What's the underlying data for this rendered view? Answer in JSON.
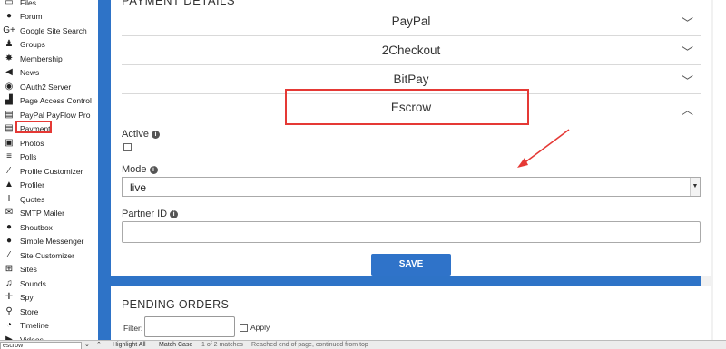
{
  "sidebar": {
    "items": [
      {
        "label": "Files",
        "icon": "file-icon",
        "glyph": "▭"
      },
      {
        "label": "Forum",
        "icon": "chat-bubbles-icon",
        "glyph": "●"
      },
      {
        "label": "Google Site Search",
        "icon": "google-plus-icon",
        "glyph": "G+"
      },
      {
        "label": "Groups",
        "icon": "users-icon",
        "glyph": "♟"
      },
      {
        "label": "Membership",
        "icon": "cog-icon",
        "glyph": "✸"
      },
      {
        "label": "News",
        "icon": "megaphone-icon",
        "glyph": "◀"
      },
      {
        "label": "OAuth2 Server",
        "icon": "globe-icon",
        "glyph": "◉"
      },
      {
        "label": "Page Access Control",
        "icon": "unlock-icon",
        "glyph": "▟"
      },
      {
        "label": "PayPal PayFlow Pro",
        "icon": "credit-card-icon",
        "glyph": "▤"
      },
      {
        "label": "Payment",
        "icon": "credit-card-icon",
        "glyph": "▤"
      },
      {
        "label": "Photos",
        "icon": "image-icon",
        "glyph": "▣"
      },
      {
        "label": "Polls",
        "icon": "tasks-icon",
        "glyph": "≡"
      },
      {
        "label": "Profile Customizer",
        "icon": "magic-wand-icon",
        "glyph": "⁄"
      },
      {
        "label": "Profiler",
        "icon": "flask-icon",
        "glyph": "▲"
      },
      {
        "label": "Quotes",
        "icon": "italic-icon",
        "glyph": "I"
      },
      {
        "label": "SMTP Mailer",
        "icon": "envelope-icon",
        "glyph": "✉"
      },
      {
        "label": "Shoutbox",
        "icon": "comment-icon",
        "glyph": "●"
      },
      {
        "label": "Simple Messenger",
        "icon": "comments-icon",
        "glyph": "●"
      },
      {
        "label": "Site Customizer",
        "icon": "magic-wand-icon",
        "glyph": "⁄"
      },
      {
        "label": "Sites",
        "icon": "sitemap-icon",
        "glyph": "⊞"
      },
      {
        "label": "Sounds",
        "icon": "music-icon",
        "glyph": "♫"
      },
      {
        "label": "Spy",
        "icon": "crosshairs-icon",
        "glyph": "✛"
      },
      {
        "label": "Store",
        "icon": "shopping-cart-icon",
        "glyph": "⚲"
      },
      {
        "label": "Timeline",
        "icon": "clock-icon",
        "glyph": "◔"
      },
      {
        "label": "Videos",
        "icon": "video-icon",
        "glyph": "▶"
      }
    ]
  },
  "payment": {
    "section_title": "PAYMENT DETAILS",
    "providers": [
      {
        "label": "PayPal",
        "chevron": "﹀"
      },
      {
        "label": "2Checkout",
        "chevron": "﹀"
      },
      {
        "label": "BitPay",
        "chevron": "﹀"
      },
      {
        "label": "Escrow",
        "chevron": "︿"
      }
    ],
    "active_label": "Active",
    "mode_label": "Mode",
    "mode_value": "live",
    "partner_label": "Partner ID",
    "partner_value": "",
    "save_label": "SAVE"
  },
  "pending": {
    "title": "PENDING ORDERS",
    "filter_label": "Filter:",
    "filter_value": "",
    "apply_label": "Apply"
  },
  "findbar": {
    "query": "escrow",
    "highlight_all": "Highlight All",
    "match_case": "Match Case",
    "matches": "1 of 2 matches",
    "status": "Reached end of page, continued from top"
  },
  "colors": {
    "frame_blue": "#2e73c7",
    "annotation_red": "#e53935"
  }
}
